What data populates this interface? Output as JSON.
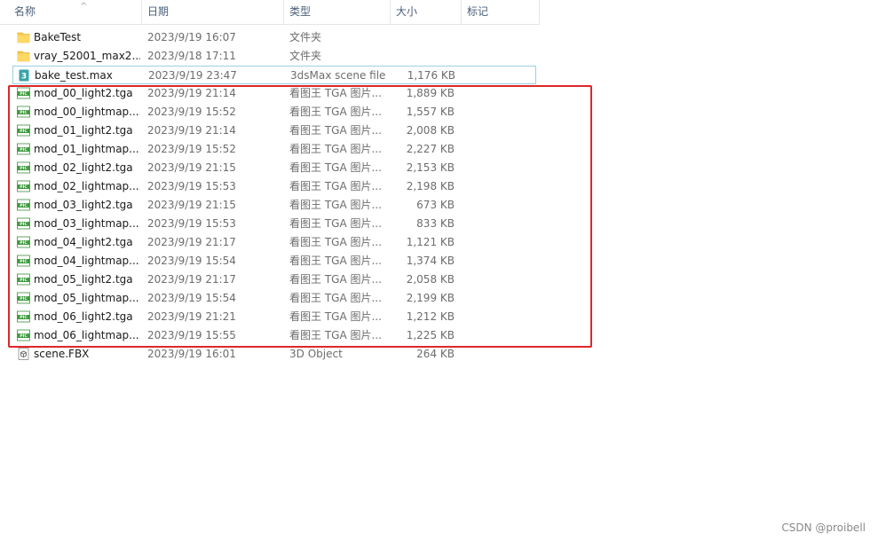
{
  "columns": {
    "name": "名称",
    "date": "日期",
    "type": "类型",
    "size": "大小",
    "tags": "标记"
  },
  "files": [
    {
      "name": "BakeTest",
      "date": "2023/9/19 16:07",
      "type": "文件夹",
      "size": "",
      "icon": "folder-icon"
    },
    {
      "name": "vray_52001_max2...",
      "date": "2023/9/18 17:11",
      "type": "文件夹",
      "size": "",
      "icon": "folder-icon"
    },
    {
      "name": "bake_test.max",
      "date": "2023/9/19 23:47",
      "type": "3dsMax scene file",
      "size": "1,176 KB",
      "icon": "3dsmax-file-icon"
    },
    {
      "name": "mod_00_light2.tga",
      "date": "2023/9/19 21:14",
      "type": "看图王 TGA 图片...",
      "size": "1,889 KB",
      "icon": "pic-file-icon"
    },
    {
      "name": "mod_00_lightmap....",
      "date": "2023/9/19 15:52",
      "type": "看图王 TGA 图片...",
      "size": "1,557 KB",
      "icon": "pic-file-icon"
    },
    {
      "name": "mod_01_light2.tga",
      "date": "2023/9/19 21:14",
      "type": "看图王 TGA 图片...",
      "size": "2,008 KB",
      "icon": "pic-file-icon"
    },
    {
      "name": "mod_01_lightmap....",
      "date": "2023/9/19 15:52",
      "type": "看图王 TGA 图片...",
      "size": "2,227 KB",
      "icon": "pic-file-icon"
    },
    {
      "name": "mod_02_light2.tga",
      "date": "2023/9/19 21:15",
      "type": "看图王 TGA 图片...",
      "size": "2,153 KB",
      "icon": "pic-file-icon"
    },
    {
      "name": "mod_02_lightmap....",
      "date": "2023/9/19 15:53",
      "type": "看图王 TGA 图片...",
      "size": "2,198 KB",
      "icon": "pic-file-icon"
    },
    {
      "name": "mod_03_light2.tga",
      "date": "2023/9/19 21:15",
      "type": "看图王 TGA 图片...",
      "size": "673 KB",
      "icon": "pic-file-icon"
    },
    {
      "name": "mod_03_lightmap....",
      "date": "2023/9/19 15:53",
      "type": "看图王 TGA 图片...",
      "size": "833 KB",
      "icon": "pic-file-icon"
    },
    {
      "name": "mod_04_light2.tga",
      "date": "2023/9/19 21:17",
      "type": "看图王 TGA 图片...",
      "size": "1,121 KB",
      "icon": "pic-file-icon"
    },
    {
      "name": "mod_04_lightmap....",
      "date": "2023/9/19 15:54",
      "type": "看图王 TGA 图片...",
      "size": "1,374 KB",
      "icon": "pic-file-icon"
    },
    {
      "name": "mod_05_light2.tga",
      "date": "2023/9/19 21:17",
      "type": "看图王 TGA 图片...",
      "size": "2,058 KB",
      "icon": "pic-file-icon"
    },
    {
      "name": "mod_05_lightmap....",
      "date": "2023/9/19 15:54",
      "type": "看图王 TGA 图片...",
      "size": "2,199 KB",
      "icon": "pic-file-icon"
    },
    {
      "name": "mod_06_light2.tga",
      "date": "2023/9/19 21:21",
      "type": "看图王 TGA 图片...",
      "size": "1,212 KB",
      "icon": "pic-file-icon"
    },
    {
      "name": "mod_06_lightmap....",
      "date": "2023/9/19 15:55",
      "type": "看图王 TGA 图片...",
      "size": "1,225 KB",
      "icon": "pic-file-icon"
    },
    {
      "name": "scene.FBX",
      "date": "2023/9/19 16:01",
      "type": "3D Object",
      "size": "264 KB",
      "icon": "3d-object-icon"
    }
  ],
  "selected_index": 2,
  "colors": {
    "highlight": "#e0262a",
    "selection_border": "#99d1e6",
    "folder": "#f5c94a"
  },
  "watermark": "CSDN @proibell"
}
